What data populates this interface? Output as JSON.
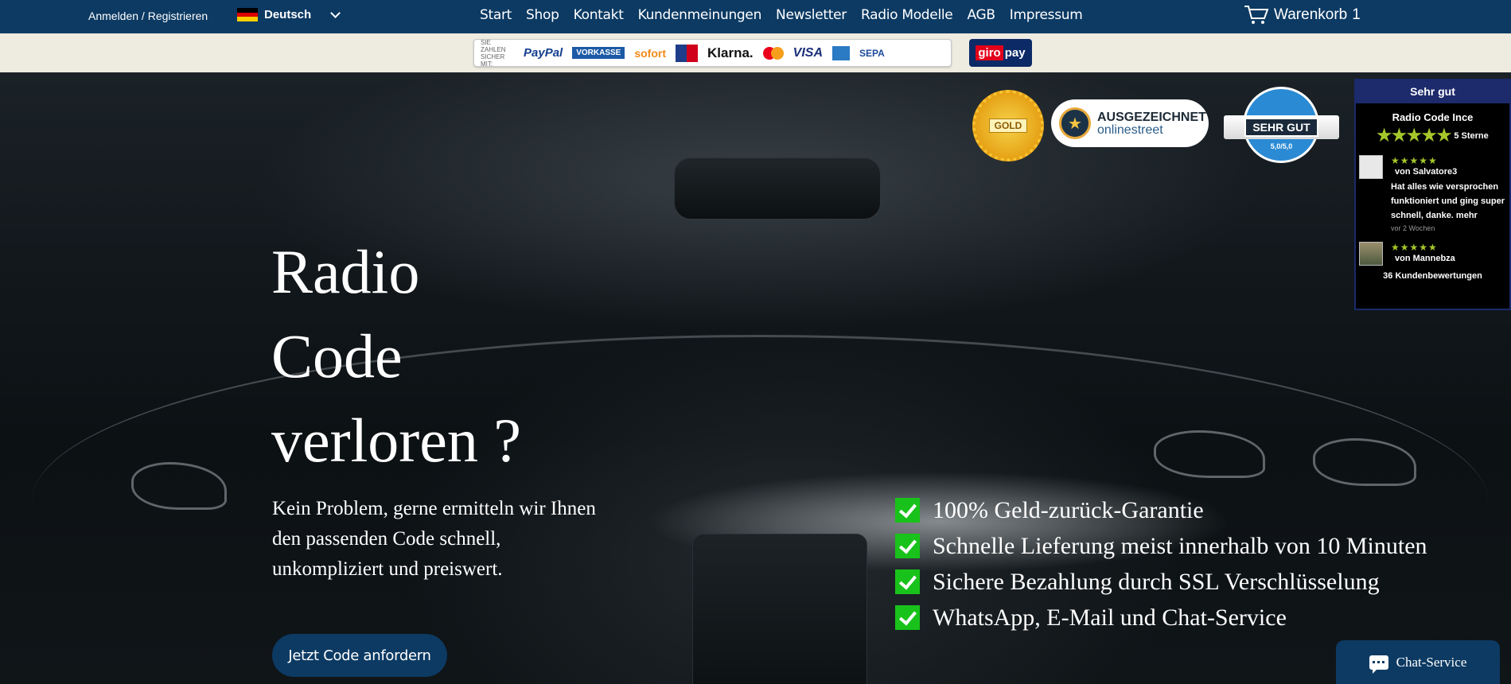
{
  "header": {
    "login_label": "Anmelden / Registrieren",
    "language": "Deutsch",
    "nav": [
      "Start",
      "Shop",
      "Kontakt",
      "Kundenmeinungen",
      "Newsletter",
      "Radio Modelle",
      "AGB",
      "Impressum"
    ],
    "cart_label": "Warenkorb",
    "cart_count": "1"
  },
  "payment": {
    "hint": "SIE ZAHLEN SICHER MIT:",
    "paypal": "PayPal",
    "vorkasse": "VORKASSE",
    "sofort": "sofort",
    "klarna": "Klarna.",
    "visa": "VISA",
    "sepa": "SEPA",
    "giropay_a": "giro",
    "giropay_b": "pay"
  },
  "hero": {
    "headline_line1": "Radio",
    "headline_line2": "Code",
    "headline_line3": "verloren ?",
    "subline": "Kein Problem, gerne ermitteln wir Ihnen den passenden Code schnell, unkompliziert und preiswert.",
    "cta_label": "Jetzt Code anfordern",
    "features": [
      "100% Geld-zurück-Garantie",
      "Schnelle Lieferung meist innerhalb von 10 Minuten",
      "Sichere Bezahlung durch SSL Verschlüsselung",
      "WhatsApp, E-Mail und Chat-Service"
    ]
  },
  "badges": {
    "gold": "GOLD",
    "ausgezeichnet": "AUSGEZEICHNET",
    "onlinestreet": "onlinestreet",
    "webwiki_rating": "SEHR GUT",
    "webwiki_score": "5,0/5,0"
  },
  "reviews": {
    "header": "Sehr gut",
    "shop_name": "Radio Code Ince",
    "stars_label": "5 Sterne",
    "items": [
      {
        "author": "von Salvatore3",
        "text": "Hat alles wie versprochen funktioniert und ging super schnell, danke. mehr",
        "time": "vor 2 Wochen"
      },
      {
        "author": "von Mannebza",
        "text": "",
        "time": ""
      }
    ],
    "count_label": "36 Kundenbewertungen"
  },
  "chat": {
    "label": "Chat-Service"
  },
  "colors": {
    "brand": "#0c3a63",
    "check": "#19c21a",
    "star": "#a5c72a"
  }
}
